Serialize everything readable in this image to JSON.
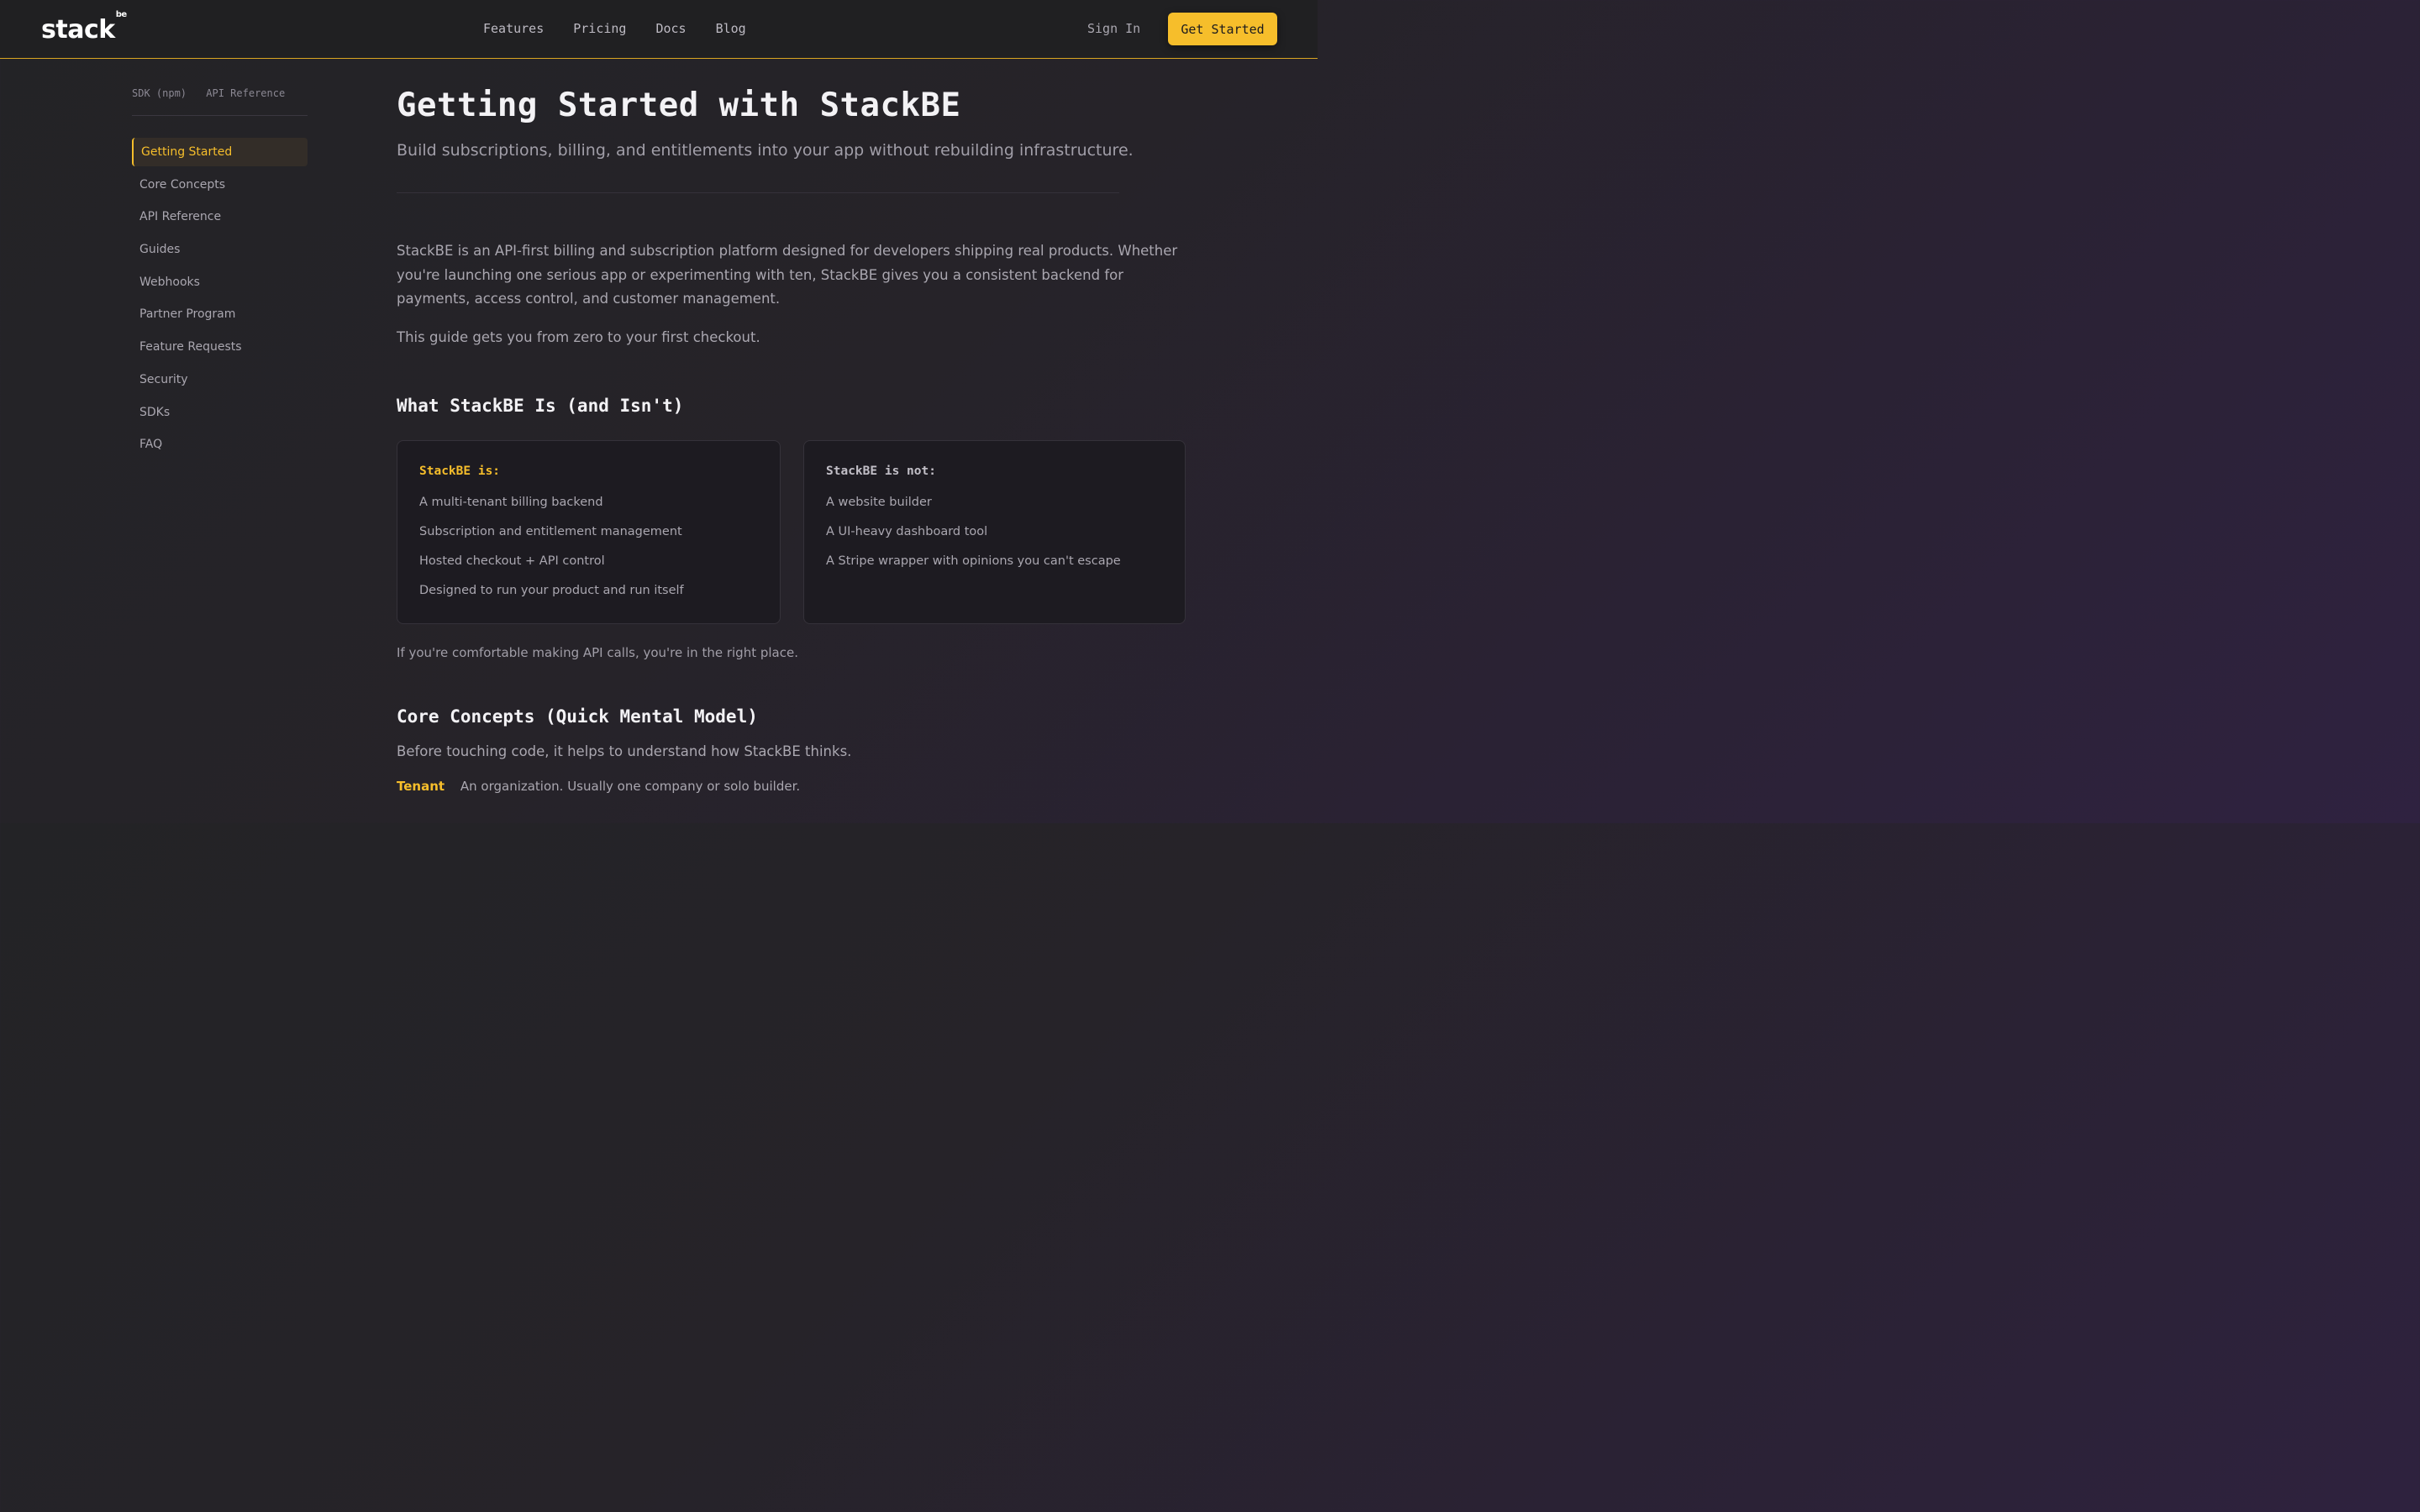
{
  "header": {
    "logo": "stack",
    "logo_sup": "be",
    "nav": [
      "Features",
      "Pricing",
      "Docs",
      "Blog"
    ],
    "sign_in": "Sign In",
    "get_started": "Get Started"
  },
  "sidebar": {
    "top_links": [
      "SDK (npm)",
      "API Reference"
    ],
    "items": [
      {
        "label": "Getting Started",
        "active": true
      },
      {
        "label": "Core Concepts"
      },
      {
        "label": "API Reference"
      },
      {
        "label": "Guides"
      },
      {
        "label": "Webhooks"
      },
      {
        "label": "Partner Program"
      },
      {
        "label": "Feature Requests"
      },
      {
        "label": "Security"
      },
      {
        "label": "SDKs"
      },
      {
        "label": "FAQ"
      }
    ]
  },
  "main": {
    "title": "Getting Started with StackBE",
    "subtitle": "Build subscriptions, billing, and entitlements into your app without rebuilding infrastructure.",
    "intro": "StackBE is an API-first billing and subscription platform designed for developers shipping real products. Whether you're launching one serious app or experimenting with ten, StackBE gives you a consistent backend for payments, access control, and customer management.",
    "intro2": "This guide gets you from zero to your first checkout.",
    "section1_title": "What StackBE Is (and Isn't)",
    "is_card": {
      "title": "StackBE is:",
      "items": [
        "A multi-tenant billing backend",
        "Subscription and entitlement management",
        "Hosted checkout + API control",
        "Designed to run your product and run itself"
      ]
    },
    "isnot_card": {
      "title": "StackBE is not:",
      "items": [
        "A website builder",
        "A UI-heavy dashboard tool",
        "A Stripe wrapper with opinions you can't escape"
      ]
    },
    "note": "If you're comfortable making API calls, you're in the right place.",
    "section2_title": "Core Concepts (Quick Mental Model)",
    "section2_intro": "Before touching code, it helps to understand how StackBE thinks.",
    "term": {
      "key": "Tenant",
      "value": "An organization. Usually one company or solo builder."
    }
  }
}
